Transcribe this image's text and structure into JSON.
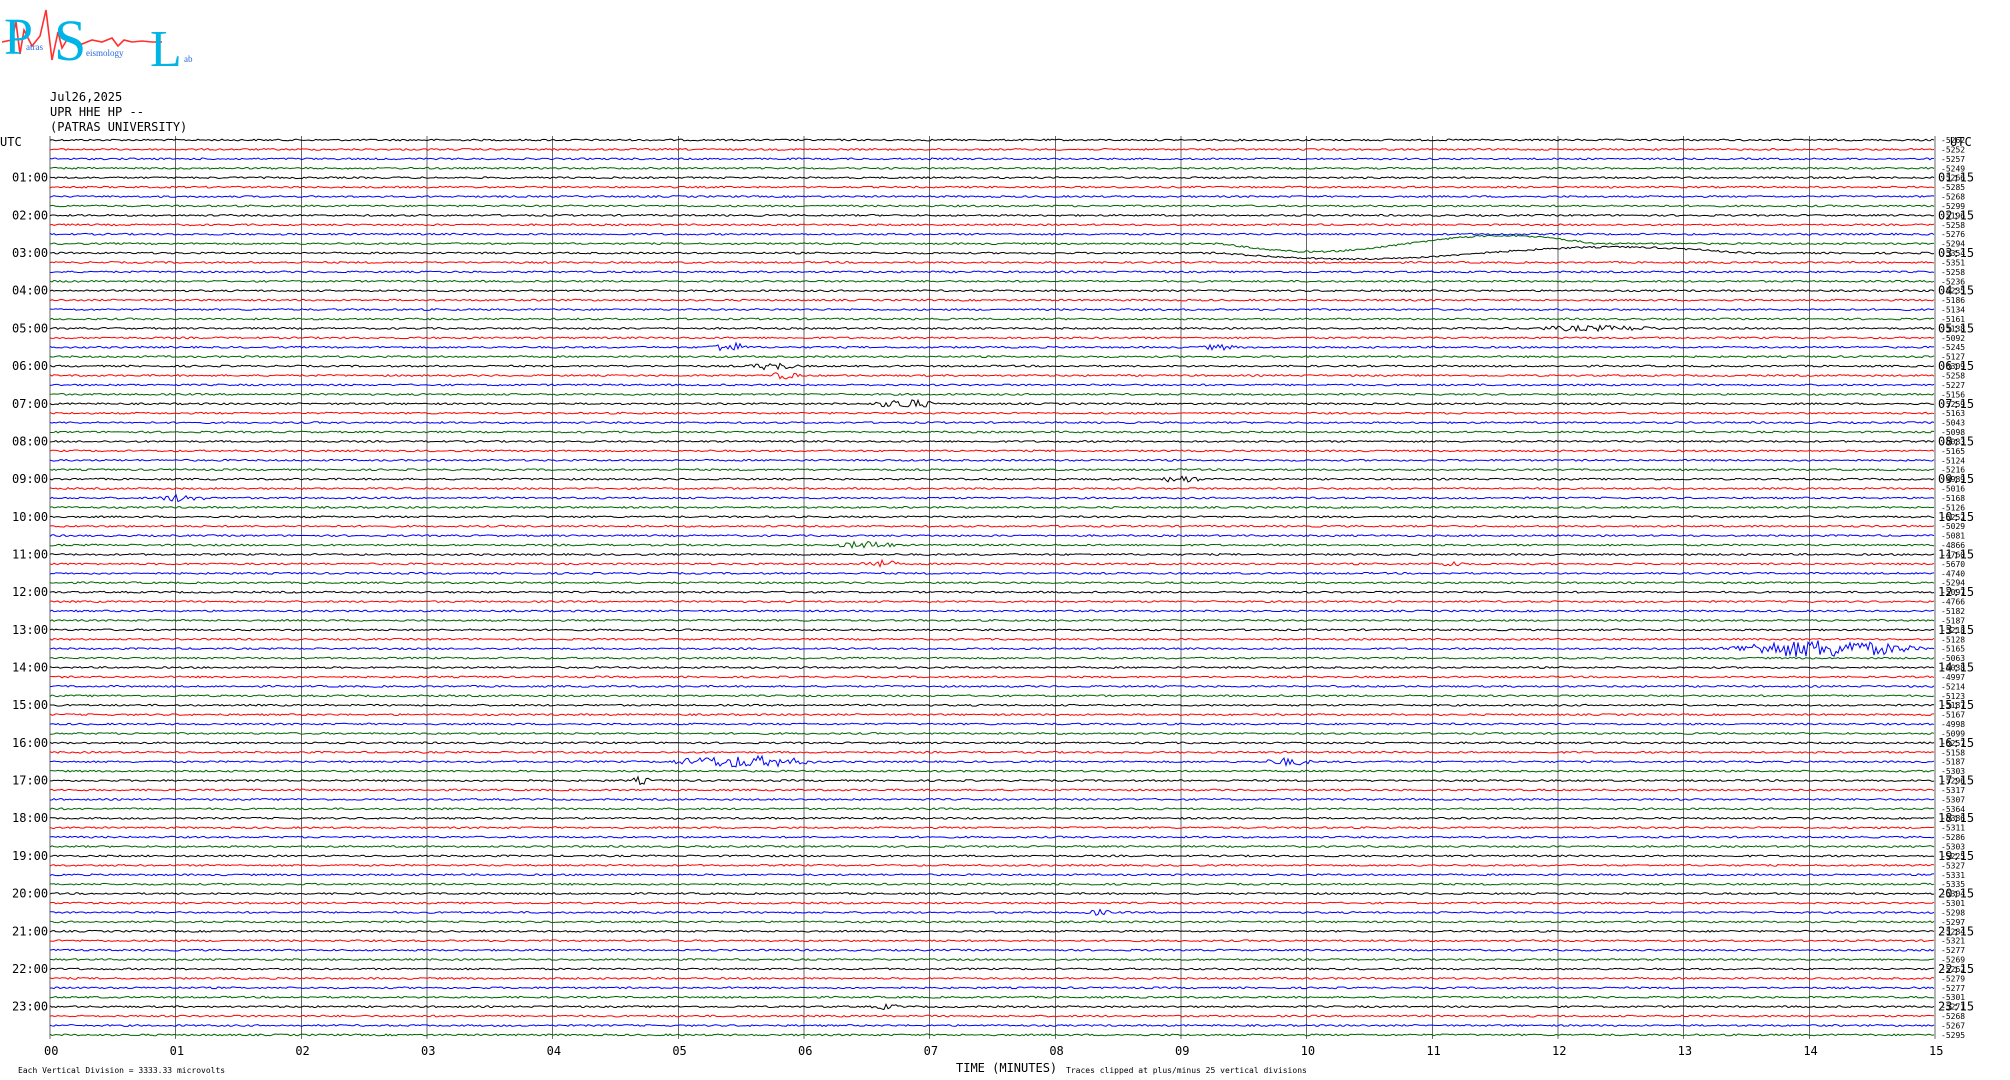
{
  "logo": {
    "letters": "PSL",
    "words": [
      "atras",
      "eismology",
      "ab"
    ]
  },
  "header": {
    "date": "Jul26,2025",
    "station": "UPR HHE HP --",
    "org": "(PATRAS UNIVERSITY)"
  },
  "footer": {
    "division_note": "Each Vertical Division = 3333.33 microvolts",
    "x_title": "TIME (MINUTES)",
    "clip_note": "Traces clipped at plus/minus 25 vertical divisions"
  },
  "chart_data": {
    "type": "line",
    "title": "",
    "xlabel": "TIME (MINUTES)",
    "xlim": [
      0,
      15
    ],
    "x_ticks": [
      "00",
      "01",
      "02",
      "03",
      "04",
      "05",
      "06",
      "07",
      "08",
      "09",
      "10",
      "11",
      "12",
      "13",
      "14",
      "15"
    ],
    "left_axis_title": "UTC",
    "right_axis_title": "UTC",
    "left_labels": [
      "01:00",
      "02:00",
      "03:00",
      "04:00",
      "05:00",
      "06:00",
      "07:00",
      "08:00",
      "09:00",
      "10:00",
      "11:00",
      "12:00",
      "13:00",
      "14:00",
      "15:00",
      "16:00",
      "17:00",
      "18:00",
      "19:00",
      "20:00",
      "21:00",
      "22:00",
      "23:00"
    ],
    "right_labels": [
      "01:15",
      "02:15",
      "03:15",
      "04:15",
      "05:15",
      "06:15",
      "07:15",
      "08:15",
      "09:15",
      "10:15",
      "11:15",
      "12:15",
      "13:15",
      "14:15",
      "15:15",
      "16:15",
      "17:15",
      "18:15",
      "19:15",
      "20:15",
      "21:15",
      "22:15",
      "23:15"
    ],
    "trace_colors": [
      "#000000",
      "#ff0000",
      "#0000ff",
      "#006400"
    ],
    "trace_count": 96,
    "trace_offsets": [
      "-5262",
      "-5252",
      "-5257",
      "-5249",
      "-5266",
      "-5285",
      "-5268",
      "-5299",
      "-5196",
      "-5258",
      "-5276",
      "-5294",
      "-5354",
      "-5351",
      "-5258",
      "-5236",
      "-5235",
      "-5186",
      "-5134",
      "-5161",
      "-5138",
      "-5092",
      "-5245",
      "-5127",
      "-5309",
      "-5258",
      "-5227",
      "-5156",
      "-5259",
      "-5163",
      "-5043",
      "-5098",
      "-5083",
      "-5165",
      "-5124",
      "-5216",
      "-4989",
      "-5016",
      "-5168",
      "-5126",
      "-5252",
      "-5029",
      "-5081",
      "-4866",
      "-4760",
      "-5670",
      "-4740",
      "-5294",
      "-5097",
      "-4766",
      "-5182",
      "-5187",
      "-5218",
      "-5128",
      "-5165",
      "-5063",
      "-5038",
      "-4997",
      "-5214",
      "-5123",
      "-5187",
      "-5167",
      "-4998",
      "-5099",
      "-5257",
      "-5158",
      "-5187",
      "-5303",
      "-5296",
      "-5317",
      "-5307",
      "-5364",
      "-5386",
      "-5311",
      "-5286",
      "-5303",
      "-5225",
      "-5327",
      "-5331",
      "-5335",
      "-5304",
      "-5301",
      "-5298",
      "-5297",
      "-5284",
      "-5321",
      "-5277",
      "-5269",
      "-5262",
      "-5279",
      "-5277",
      "-5301",
      "-5271",
      "-5268",
      "-5267",
      "-5295"
    ],
    "events": [
      {
        "trace": 11,
        "from": 9.3,
        "to": 12.3,
        "kind": "slow",
        "amp": 8
      },
      {
        "trace": 12,
        "from": 9.3,
        "to": 13.5,
        "kind": "slow",
        "amp": 6
      },
      {
        "trace": 20,
        "from": 11.6,
        "to": 13.0,
        "kind": "burst",
        "amp": 3
      },
      {
        "trace": 22,
        "from": 5.2,
        "to": 5.6,
        "kind": "burst",
        "amp": 5
      },
      {
        "trace": 22,
        "from": 9.1,
        "to": 9.5,
        "kind": "burst",
        "amp": 3
      },
      {
        "trace": 24,
        "from": 5.5,
        "to": 6.0,
        "kind": "burst",
        "amp": 4
      },
      {
        "trace": 25,
        "from": 5.7,
        "to": 6.0,
        "kind": "burst",
        "amp": 4
      },
      {
        "trace": 28,
        "from": 6.5,
        "to": 7.1,
        "kind": "burst",
        "amp": 5
      },
      {
        "trace": 36,
        "from": 8.8,
        "to": 9.2,
        "kind": "burst",
        "amp": 4
      },
      {
        "trace": 38,
        "from": 0.8,
        "to": 1.3,
        "kind": "burst",
        "amp": 4
      },
      {
        "trace": 43,
        "from": 6.2,
        "to": 6.8,
        "kind": "burst",
        "amp": 4
      },
      {
        "trace": 45,
        "from": 6.4,
        "to": 6.8,
        "kind": "burst",
        "amp": 4
      },
      {
        "trace": 45,
        "from": 11.0,
        "to": 11.3,
        "kind": "burst",
        "amp": 3
      },
      {
        "trace": 54,
        "from": 13.2,
        "to": 15.0,
        "kind": "burst",
        "amp": 9
      },
      {
        "trace": 66,
        "from": 4.8,
        "to": 6.2,
        "kind": "burst",
        "amp": 6
      },
      {
        "trace": 66,
        "from": 9.6,
        "to": 10.1,
        "kind": "burst",
        "amp": 4
      },
      {
        "trace": 68,
        "from": 4.6,
        "to": 4.8,
        "kind": "burst",
        "amp": 4
      },
      {
        "trace": 82,
        "from": 8.2,
        "to": 8.5,
        "kind": "burst",
        "amp": 3
      },
      {
        "trace": 92,
        "from": 6.5,
        "to": 6.8,
        "kind": "burst",
        "amp": 3
      }
    ],
    "grid": true
  }
}
